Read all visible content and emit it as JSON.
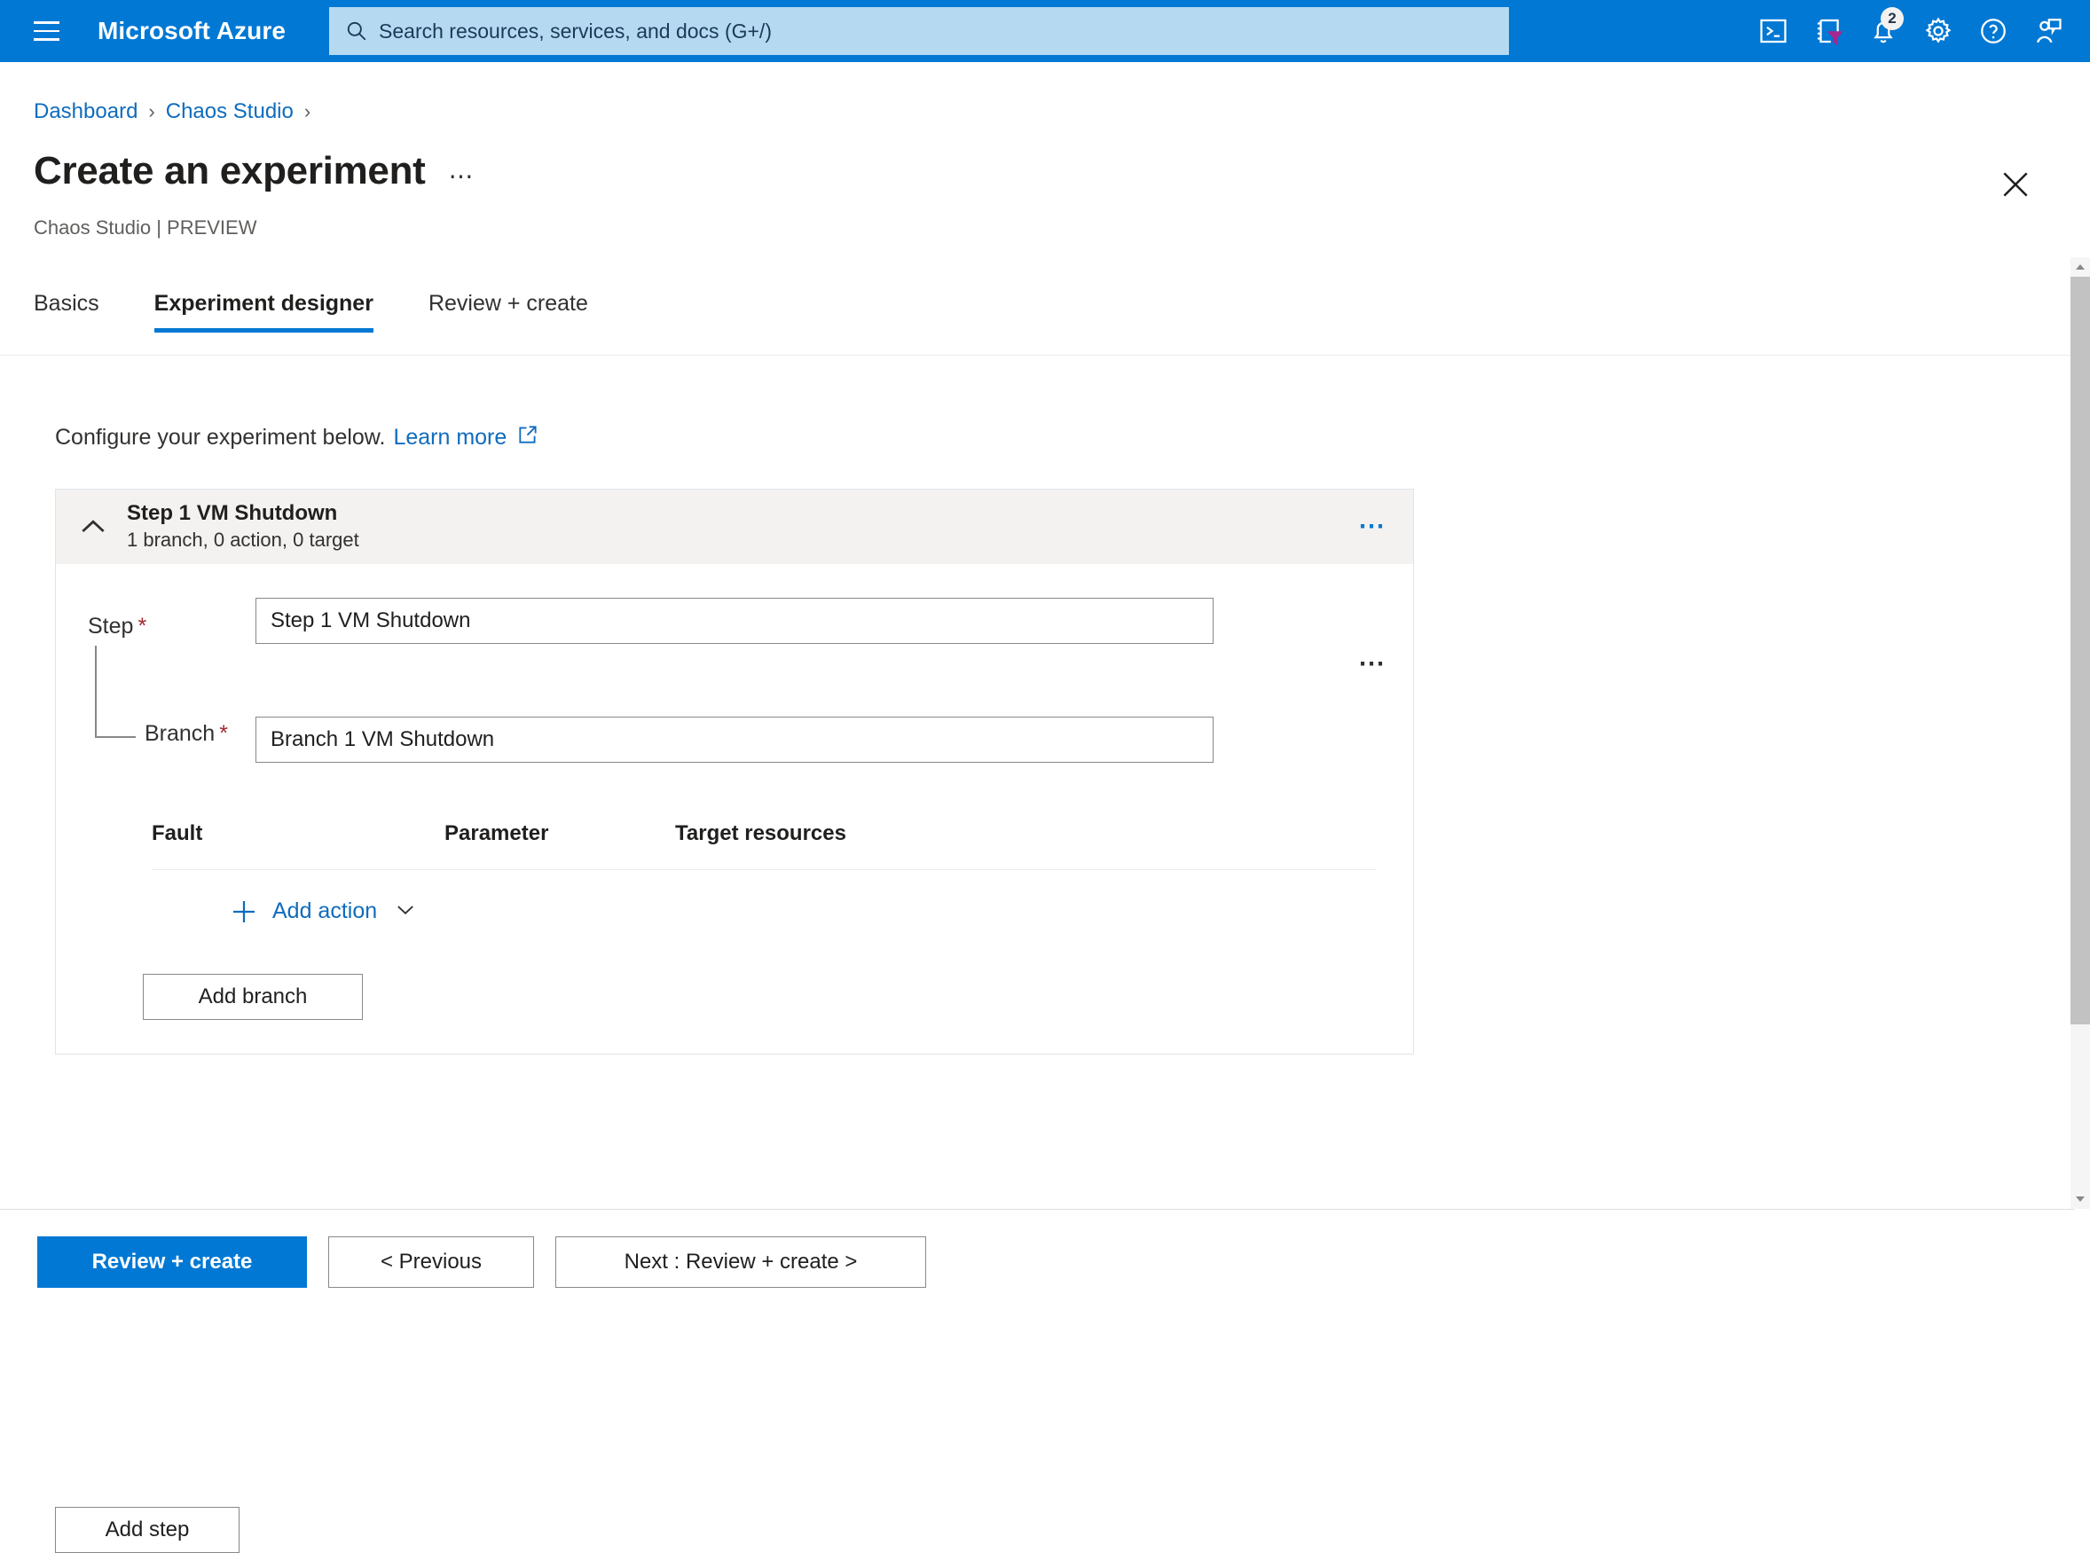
{
  "topbar": {
    "menu_icon": "hamburger-icon",
    "brand": "Microsoft Azure",
    "search": {
      "icon": "search-icon",
      "placeholder": "Search resources, services, and docs (G+/)"
    },
    "icons": [
      {
        "name": "cloud-shell-icon",
        "label": "Cloud Shell"
      },
      {
        "name": "directory-filter-icon",
        "label": "Directories + subscriptions"
      },
      {
        "name": "notifications-bell-icon",
        "label": "Notifications",
        "badge": "2"
      },
      {
        "name": "settings-gear-icon",
        "label": "Settings"
      },
      {
        "name": "help-question-icon",
        "label": "Help"
      },
      {
        "name": "feedback-icon",
        "label": "Feedback"
      }
    ],
    "accent": "#0078d4"
  },
  "breadcrumb": {
    "items": [
      "Dashboard",
      "Chaos Studio"
    ],
    "separator": "›"
  },
  "header": {
    "title": "Create an experiment",
    "more_menu": "⋯",
    "subtitle": "Chaos Studio | PREVIEW",
    "close_label": "Close"
  },
  "tabs": [
    {
      "label": "Basics",
      "active": false
    },
    {
      "label": "Experiment designer",
      "active": true
    },
    {
      "label": "Review + create",
      "active": false
    }
  ],
  "main": {
    "intro_text": "Configure your experiment below.",
    "learn_more": "Learn more",
    "external_link_icon": "external-link-icon",
    "step_card": {
      "collapse_icon": "chevron-up-icon",
      "title": "Step 1 VM Shutdown",
      "summary": "1 branch, 0 action, 0 target",
      "menu": "⋯",
      "step_label": "Step",
      "step_required": "*",
      "step_value": "Step 1 VM Shutdown",
      "branch_label": "Branch",
      "branch_required": "*",
      "branch_value": "Branch 1 VM Shutdown",
      "branch_menu": "⋯",
      "table": {
        "columns": [
          "Fault",
          "Parameter",
          "Target resources"
        ],
        "rows": []
      },
      "add_action": {
        "icon": "plus-icon",
        "label": "Add action",
        "chevron": "chevron-down-icon"
      },
      "add_branch_label": "Add branch"
    },
    "add_step_label": "Add step"
  },
  "footer": {
    "primary": "Review + create",
    "previous": "< Previous",
    "next": "Next : Review + create >"
  },
  "scrollbar": {
    "up_arrow": "scroll-up-arrow",
    "down_arrow": "scroll-down-arrow"
  }
}
